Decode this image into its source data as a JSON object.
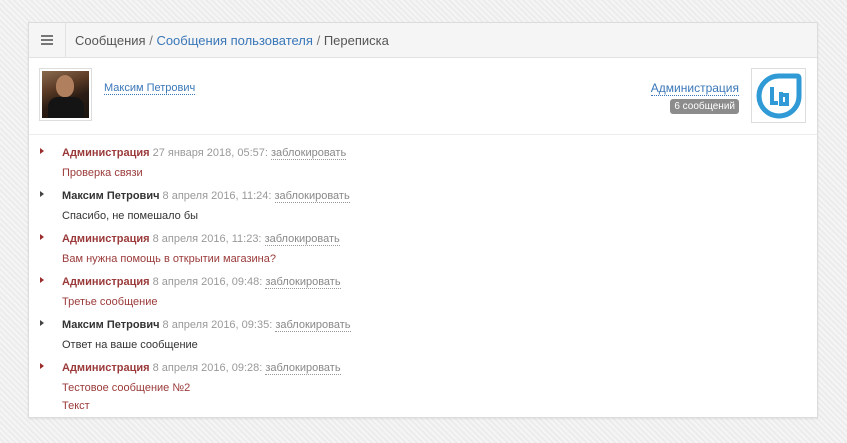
{
  "breadcrumb": {
    "root": "Сообщения",
    "middle": "Сообщения пользователя",
    "current": "Переписка",
    "separator": "/"
  },
  "users": {
    "left_name": "Максим Петрович",
    "right_name": "Администрация",
    "message_count": "6 сообщений"
  },
  "block_label": "заблокировать",
  "colors": {
    "admin_text": "#9b3a3a",
    "link": "#3a77b8",
    "badge_bg": "#8c8c8c",
    "logo": "#2f9ad6"
  },
  "messages": [
    {
      "author": "Администрация",
      "date": "27 января 2018, 05:57:",
      "lines": [
        "Проверка связи"
      ],
      "is_admin": true
    },
    {
      "author": "Максим Петрович",
      "date": "8 апреля 2016, 11:24:",
      "lines": [
        "Спасибо, не помешало бы"
      ],
      "is_admin": false
    },
    {
      "author": "Администрация",
      "date": "8 апреля 2016, 11:23:",
      "lines": [
        "Вам нужна помощь в открытии магазина?"
      ],
      "is_admin": true
    },
    {
      "author": "Администрация",
      "date": "8 апреля 2016, 09:48:",
      "lines": [
        "Третье сообщение"
      ],
      "is_admin": true
    },
    {
      "author": "Максим Петрович",
      "date": "8 апреля 2016, 09:35:",
      "lines": [
        "Ответ на ваше сообщение"
      ],
      "is_admin": false
    },
    {
      "author": "Администрация",
      "date": "8 апреля 2016, 09:28:",
      "lines": [
        "Тестовое сообщение №2",
        "Текст"
      ],
      "is_admin": true
    }
  ]
}
